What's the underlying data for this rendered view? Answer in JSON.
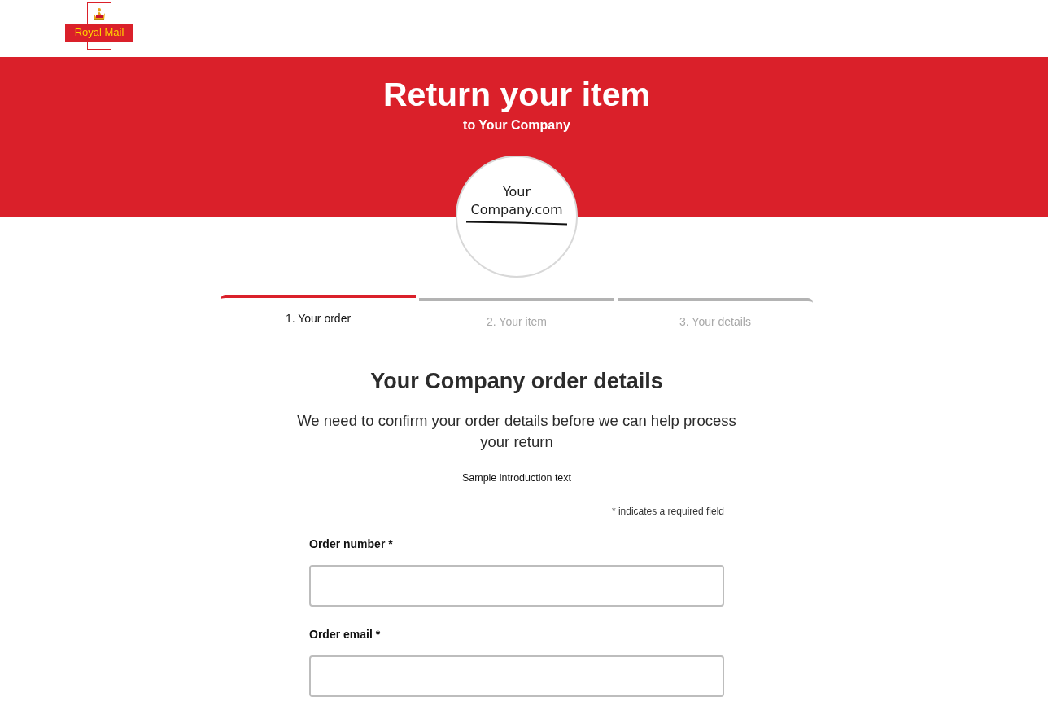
{
  "header": {
    "logo": {
      "wordmark": "Royal Mail"
    }
  },
  "hero": {
    "title": "Return your item",
    "subtitle": "to Your Company"
  },
  "company_logo": {
    "lines": [
      "Your",
      "Company.com"
    ]
  },
  "steps": [
    {
      "label": "1. Your order",
      "selected": true
    },
    {
      "label": "2. Your item",
      "selected": false
    },
    {
      "label": "3. Your details",
      "selected": false
    }
  ],
  "form": {
    "heading": "Your Company order details",
    "intro": "We need to confirm your order details before we can help process your return",
    "sample_text": "Sample introduction text",
    "required_note": "* indicates a required field",
    "fields": [
      {
        "label": "Order number *"
      },
      {
        "label": "Order email *"
      }
    ]
  }
}
